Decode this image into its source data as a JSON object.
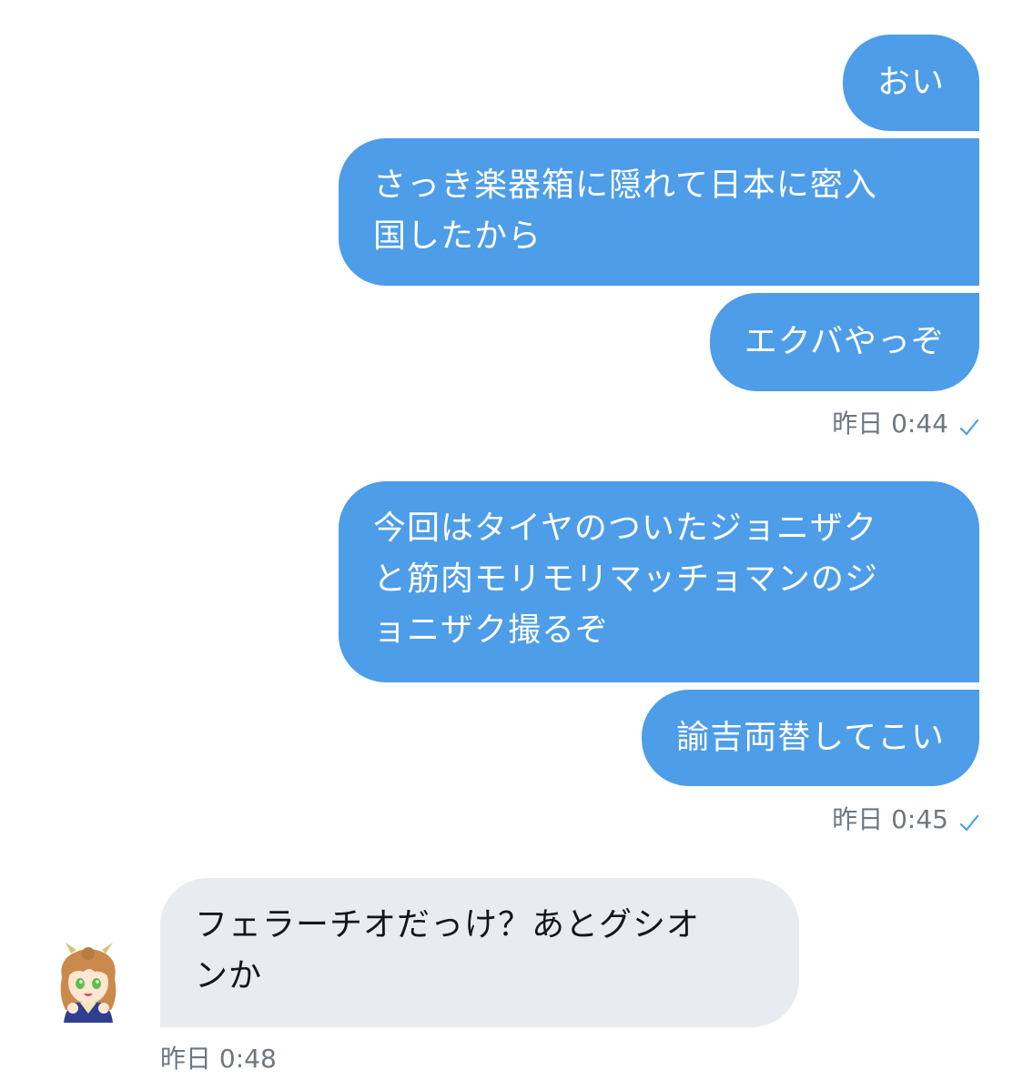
{
  "conversation": {
    "messages": [
      {
        "direction": "outgoing",
        "text": "おい"
      },
      {
        "direction": "outgoing",
        "text": "さっき楽器箱に隠れて日本に密入\n国したから"
      },
      {
        "direction": "outgoing",
        "text": "エクバやっぞ"
      },
      {
        "direction": "outgoing",
        "text": "今回はタイヤのついたジョニザク\nと筋肉モリモリマッチョマンのジ\nョニザク撮るぞ"
      },
      {
        "direction": "outgoing",
        "text": "諭吉両替してこい"
      },
      {
        "direction": "incoming",
        "text": "フェラーチオだっけ？あとグシオ\nンか"
      }
    ],
    "timestamps": [
      {
        "text": "昨日 0:44"
      },
      {
        "text": "昨日 0:45"
      },
      {
        "text": "昨日 0:48"
      }
    ]
  },
  "icons": {
    "read_receipt": "check-icon",
    "sender_avatar": "avatar"
  },
  "colors": {
    "outgoing_bubble": "#4d9de8",
    "incoming_bubble": "#e8ecf0",
    "timestamp": "#6e7780",
    "check": "#4d9de8"
  }
}
